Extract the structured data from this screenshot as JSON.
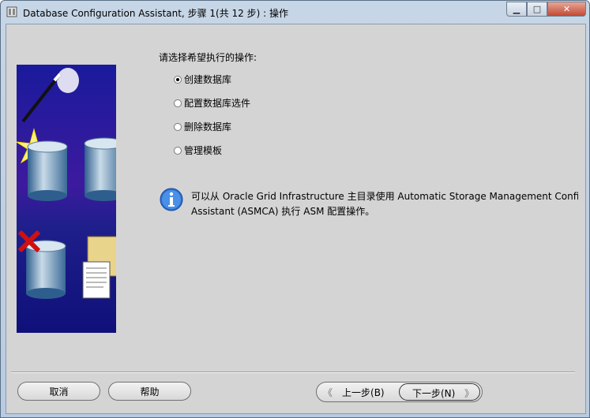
{
  "window": {
    "title": "Database Configuration Assistant, 步骤 1(共 12 步) : 操作",
    "min_glyph": "▁",
    "max_glyph": "□",
    "close_glyph": "✕"
  },
  "main": {
    "prompt": "请选择希望执行的操作:",
    "options": [
      {
        "label": "创建数据库",
        "selected": true
      },
      {
        "label": "配置数据库选件",
        "selected": false
      },
      {
        "label": "删除数据库",
        "selected": false
      },
      {
        "label": "管理模板",
        "selected": false
      }
    ],
    "info_lines": [
      "可以从 Oracle Grid Infrastructure 主目录使用 Automatic Storage Management Configuration",
      "Assistant (ASMCA) 执行 ASM 配置操作。"
    ]
  },
  "footer": {
    "cancel": "取消",
    "help": "帮助",
    "back": "上一步(B)",
    "next": "下一步(N)",
    "back_arrow": "《",
    "next_arrow": "》"
  },
  "colors": {
    "panel_bg": "#d4d4d4",
    "wizard_blue": "#1b1b9a",
    "check_red": "#d01010"
  },
  "icons": [
    "app-icon",
    "minimize-icon",
    "maximize-icon",
    "close-icon",
    "wizard-illustration",
    "info-icon"
  ]
}
